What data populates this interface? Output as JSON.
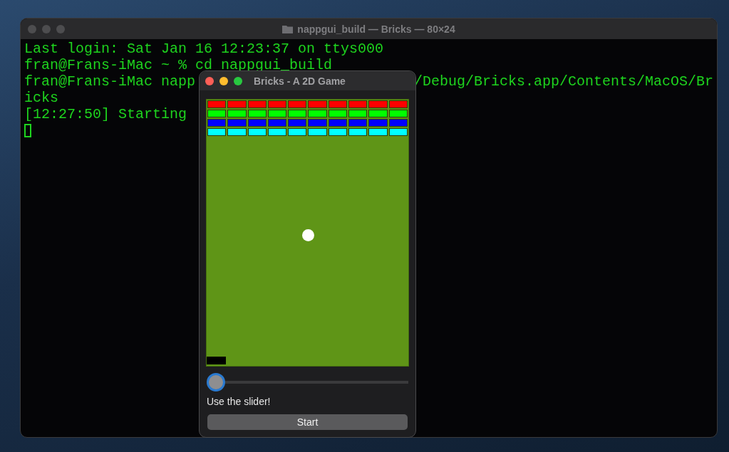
{
  "terminal": {
    "title": "nappgui_build — Bricks — 80×24",
    "lines": [
      {
        "left": "Last login: Sat Jan 16 12:23:37 on ttys000"
      },
      {
        "left": "fran@Frans-iMac ~ % cd nappgui_build"
      },
      {
        "left": "fran@Frans-iMac napp",
        "right": "/Debug/Bricks.app/Contents/MacOS/Br"
      },
      {
        "left": "icks"
      },
      {
        "left": "[12:27:50] Starting"
      }
    ]
  },
  "game_window": {
    "title": "Bricks - A 2D Game",
    "brick_rows": [
      {
        "color": "#ff0000"
      },
      {
        "color": "#00ff00"
      },
      {
        "color": "#0000ff"
      },
      {
        "color": "#00ffff"
      }
    ],
    "slider": {
      "level": 0
    },
    "slider_label": "Use the slider!",
    "button": "Start"
  }
}
